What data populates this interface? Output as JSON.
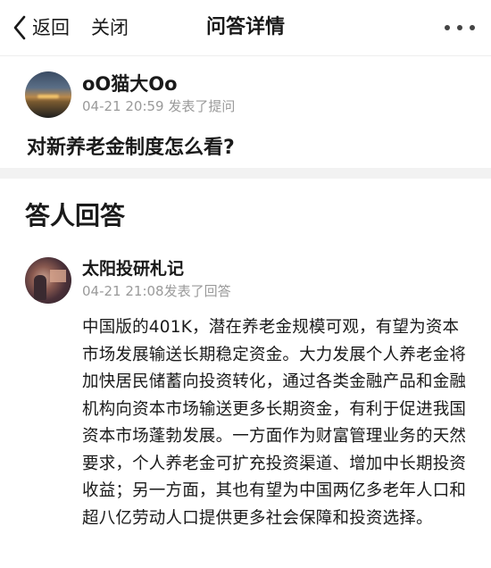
{
  "navbar": {
    "back_label": "返回",
    "close_label": "关闭",
    "title": "问答详情",
    "more_icon": "more-dots-icon"
  },
  "question": {
    "asker_name": "oO猫大Oo",
    "meta": "04-21 20:59 发表了提问",
    "text": "对新养老金制度怎么看?"
  },
  "answers": {
    "heading": "答人回答",
    "items": [
      {
        "author": "太阳投研札记",
        "meta": "04-21 21:08发表了回答",
        "body": "中国版的401K，潜在养老金规模可观，有望为资本市场发展输送长期稳定资金。大力发展个人养老金将加快居民储蓄向投资转化，通过各类金融产品和金融机构向资本市场输送更多长期资金，有利于促进我国资本市场蓬勃发展。一方面作为财富管理业务的天然要求，个人养老金可扩充投资渠道、增加中长期投资收益；另一方面，其也有望为中国两亿多老年人口和超八亿劳动人口提供更多社会保障和投资选择。"
      }
    ]
  },
  "colors": {
    "text_primary": "#1a1a1a",
    "text_secondary": "#9a9a9a",
    "divider": "#f2f2f2"
  }
}
